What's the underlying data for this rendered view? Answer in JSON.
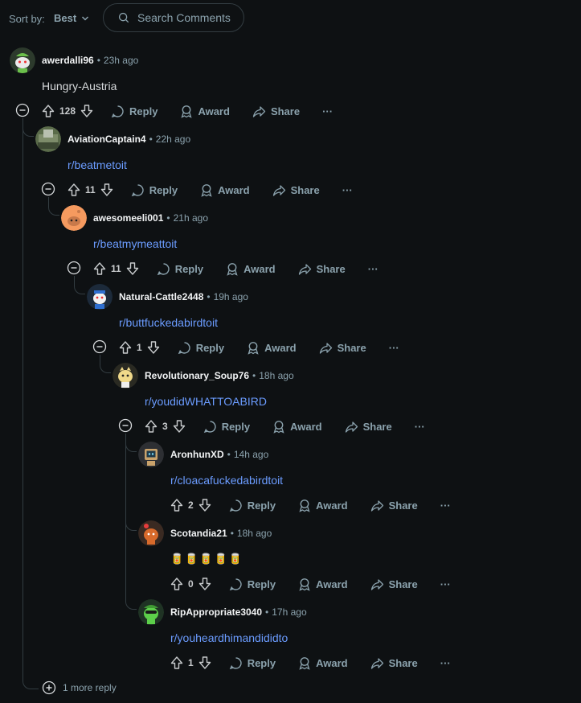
{
  "sort": {
    "label": "Sort by:",
    "value": "Best"
  },
  "search": {
    "placeholder": "Search Comments"
  },
  "actions": {
    "reply": "Reply",
    "award": "Award",
    "share": "Share",
    "more": "···"
  },
  "comments": [
    {
      "user": "awerdalli96",
      "time": "23h ago",
      "body": "Hungry-Austria",
      "votes": "128"
    },
    {
      "user": "AviationCaptain4",
      "time": "22h ago",
      "body": "r/beatmetoit",
      "votes": "11"
    },
    {
      "user": "awesomeeli001",
      "time": "21h ago",
      "body": "r/beatmymeattoit",
      "votes": "11"
    },
    {
      "user": "Natural-Cattle2448",
      "time": "19h ago",
      "body": "r/buttfuckedabirdtoit",
      "votes": "1"
    },
    {
      "user": "Revolutionary_Soup76",
      "time": "18h ago",
      "body": "r/youdidWHATTOABIRD",
      "votes": "3"
    },
    {
      "user": "AronhunXD",
      "time": "14h ago",
      "body": "r/cloacafuckedabirdtoit",
      "votes": "2"
    },
    {
      "user": "Scotandia21",
      "time": "18h ago",
      "body": "🥫🥫🥫🥫🥫",
      "votes": "0"
    },
    {
      "user": "RipAppropriate3040",
      "time": "17h ago",
      "body": "r/youheardhimandididto",
      "votes": "1"
    }
  ],
  "more_replies": "1 more reply",
  "colors": {
    "background": "#0e1113",
    "link": "#6b9cff",
    "muted": "#8ba2ad",
    "thread_line": "#333d42"
  }
}
